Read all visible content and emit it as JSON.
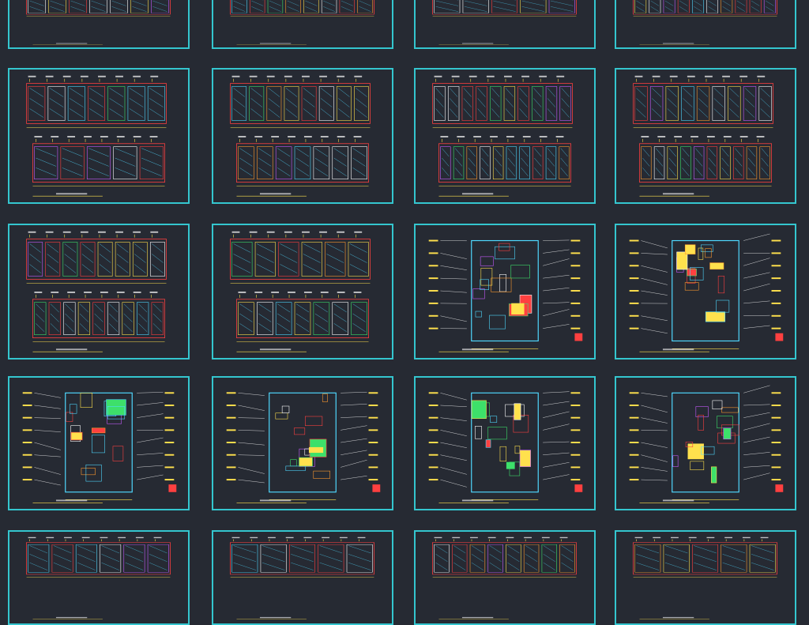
{
  "gallery": {
    "background": "#262a33",
    "frame_color": "#34c6cf",
    "rows": [
      {
        "row": 1,
        "kind": "elevation-sheets-cropped"
      },
      {
        "row": 2,
        "kind": "elevation-sheets"
      },
      {
        "row": 3,
        "kind": "elevations-and-ceiling-plans"
      },
      {
        "row": 4,
        "kind": "floor-plan-sheets"
      },
      {
        "row": 5,
        "kind": "elevation-sheets-cropped"
      }
    ],
    "sheet_count": 20
  }
}
